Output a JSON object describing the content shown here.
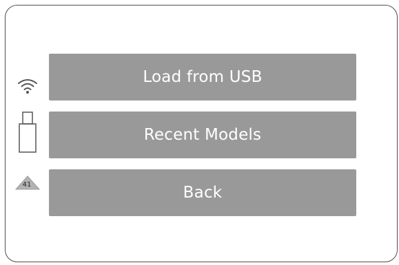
{
  "menu": {
    "load_usb_label": "Load from USB",
    "recent_models_label": "Recent Models",
    "back_label": "Back"
  },
  "status": {
    "wifi_icon": "wifi-icon",
    "usb_icon": "usb-drive-icon",
    "alert_icon": "warning-triangle-icon",
    "alert_count": "41"
  },
  "colors": {
    "button_bg": "#999999",
    "button_text": "#ffffff",
    "frame_border": "#4d4d4d",
    "icon_stroke": "#555555",
    "badge_fill": "#b3b3b3"
  }
}
